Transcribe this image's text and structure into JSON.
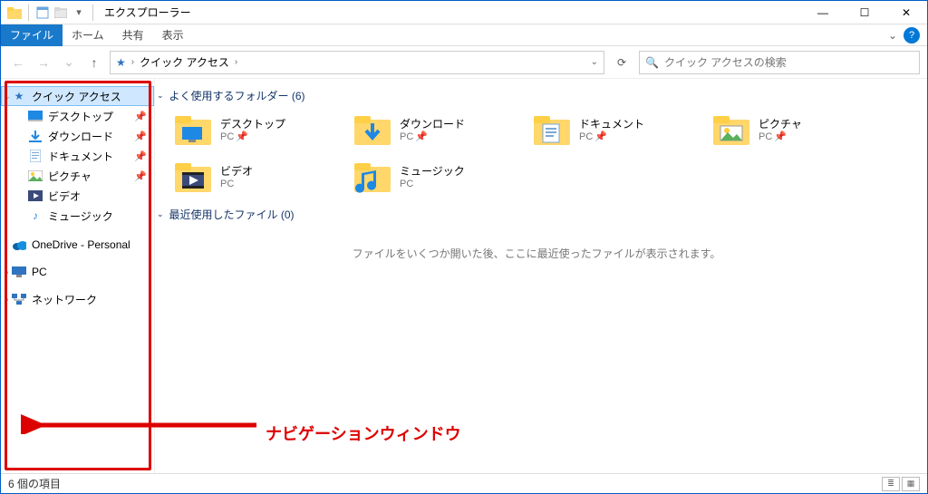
{
  "window": {
    "title": "エクスプローラー",
    "minimize": "—",
    "maximize": "☐",
    "close": "✕"
  },
  "ribbon": {
    "file": "ファイル",
    "home": "ホーム",
    "share": "共有",
    "view": "表示",
    "expand_glyph": "⌄",
    "help_glyph": "?"
  },
  "nav": {
    "back_glyph": "←",
    "forward_glyph": "→",
    "recent_glyph": "⌄",
    "up_glyph": "↑",
    "star_glyph": "★",
    "crumb0": "クイック アクセス",
    "sep_glyph": "›",
    "drop_glyph": "⌄",
    "refresh_glyph": "⟳"
  },
  "search": {
    "icon": "🔍",
    "placeholder": "クイック アクセスの検索"
  },
  "tree": {
    "quick_access": "クイック アクセス",
    "desktop": "デスクトップ",
    "downloads": "ダウンロード",
    "documents": "ドキュメント",
    "pictures": "ピクチャ",
    "videos": "ビデオ",
    "music": "ミュージック",
    "onedrive": "OneDrive - Personal",
    "pc": "PC",
    "network": "ネットワーク",
    "pin_glyph": "📌",
    "expand_glyph": "⌄",
    "collapse_glyph": "›"
  },
  "content": {
    "group_freq": "よく使用するフォルダー (6)",
    "group_recent": "最近使用したファイル (0)",
    "recent_empty": "ファイルをいくつか開いた後、ここに最近使ったファイルが表示されます。",
    "folders": [
      {
        "name": "デスクトップ",
        "loc": "PC",
        "pin": true,
        "kind": "desktop"
      },
      {
        "name": "ダウンロード",
        "loc": "PC",
        "pin": true,
        "kind": "downloads"
      },
      {
        "name": "ドキュメント",
        "loc": "PC",
        "pin": true,
        "kind": "documents"
      },
      {
        "name": "ピクチャ",
        "loc": "PC",
        "pin": true,
        "kind": "pictures"
      },
      {
        "name": "ビデオ",
        "loc": "PC",
        "pin": false,
        "kind": "videos"
      },
      {
        "name": "ミュージック",
        "loc": "PC",
        "pin": false,
        "kind": "music"
      }
    ]
  },
  "annotation": {
    "label": "ナビゲーションウィンドウ"
  },
  "status": {
    "count": "6 個の項目"
  },
  "icons": {
    "explorer": "folder",
    "qat_props": "props",
    "qat_new": "new"
  }
}
